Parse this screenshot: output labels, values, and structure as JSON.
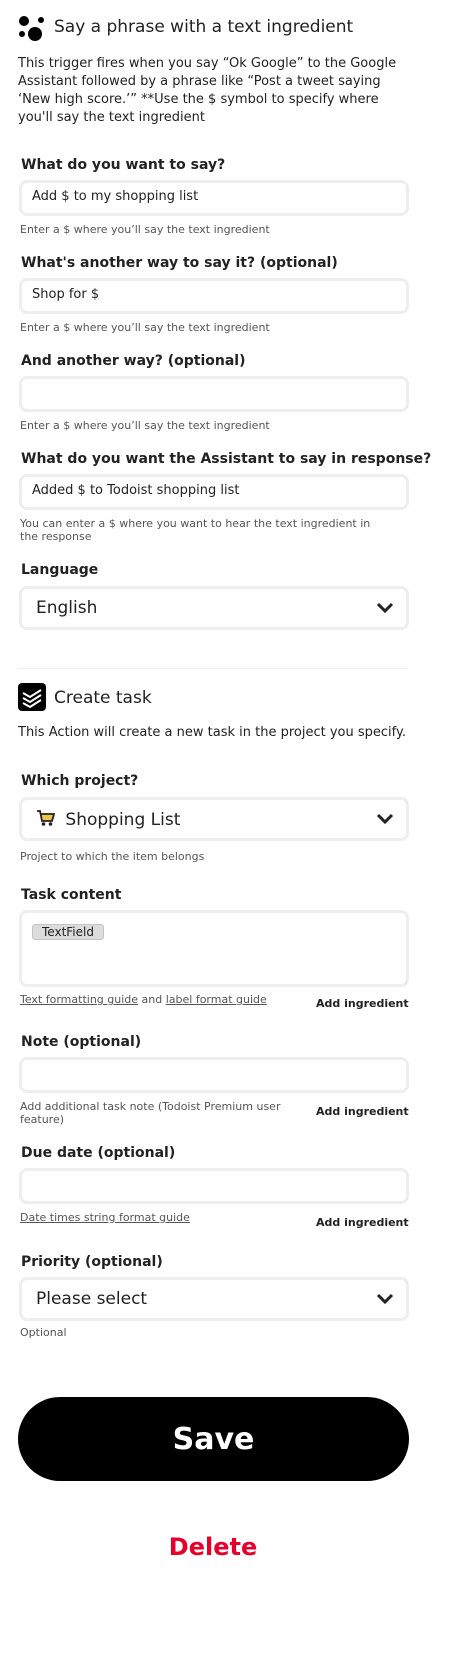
{
  "trigger": {
    "title": "Say a phrase with a text ingredient",
    "description": "This trigger fires when you say “Ok Google” to the Google Assistant followed by a phrase like “Post a tweet saying ‘New high score.’” **Use the $ symbol to specify where you'll say the text ingredient",
    "fields": [
      {
        "label": "What do you want to say?",
        "value": "Add $ to my shopping list",
        "hint": "Enter a $ where you’ll say the text ingredient"
      },
      {
        "label": "What's another way to say it? (optional)",
        "value": "Shop for $",
        "hint": "Enter a $ where you’ll say the text ingredient"
      },
      {
        "label": "And another way? (optional)",
        "value": "",
        "hint": "Enter a $ where you’ll say the text ingredient"
      },
      {
        "label": "What do you want the Assistant to say in response?",
        "value": "Added $ to Todoist shopping list",
        "hint": "You can enter a $ where you want to hear the text ingredient in the response"
      }
    ],
    "language": {
      "label": "Language",
      "value": "English"
    }
  },
  "action": {
    "title": "Create task",
    "description": "This Action will create a new task in the project you specify.",
    "project": {
      "label": "Which project?",
      "icon": "shopping-cart-icon",
      "value": "Shopping List",
      "hint": "Project to which the item belongs"
    },
    "task_content": {
      "label": "Task content",
      "tag": "TextField",
      "link1": "Text formatting guide",
      "and_text": "and",
      "link2": "label format guide",
      "add_ingredient": "Add ingredient"
    },
    "note": {
      "label": "Note (optional)",
      "value": "",
      "hint": "Add additional task note (Todoist Premium user feature)",
      "add_ingredient": "Add ingredient"
    },
    "due_date": {
      "label": "Due date (optional)",
      "value": "",
      "link": "Date times string format guide",
      "add_ingredient": "Add ingredient"
    },
    "priority": {
      "label": "Priority (optional)",
      "value": "Please select",
      "hint": "Optional"
    }
  },
  "buttons": {
    "save": "Save",
    "delete": "Delete"
  },
  "colors": {
    "primary": "#000000",
    "delete": "#e4002b",
    "field_border": "#eeeeee"
  }
}
